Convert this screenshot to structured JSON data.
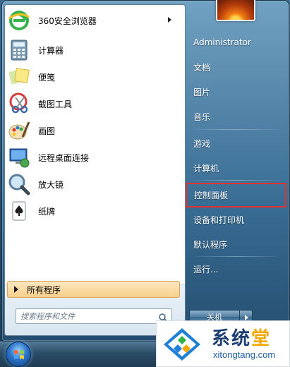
{
  "programs": [
    {
      "label": "360安全浏览器",
      "icon": "browser-360-icon",
      "has_submenu": true
    },
    {
      "label": "计算器",
      "icon": "calculator-icon"
    },
    {
      "label": "便笺",
      "icon": "sticky-notes-icon"
    },
    {
      "label": "截图工具",
      "icon": "snipping-tool-icon"
    },
    {
      "label": "画图",
      "icon": "paint-icon"
    },
    {
      "label": "远程桌面连接",
      "icon": "remote-desktop-icon"
    },
    {
      "label": "放大镜",
      "icon": "magnifier-icon"
    },
    {
      "label": "纸牌",
      "icon": "solitaire-icon"
    }
  ],
  "all_programs_label": "所有程序",
  "search": {
    "placeholder": "搜索程序和文件"
  },
  "right_menu": [
    {
      "label": "Administrator"
    },
    {
      "label": "文档"
    },
    {
      "label": "图片"
    },
    {
      "label": "音乐"
    },
    {
      "label": "游戏"
    },
    {
      "label": "计算机"
    },
    {
      "label": "控制面板",
      "highlighted": true
    },
    {
      "label": "设备和打印机"
    },
    {
      "label": "默认程序"
    },
    {
      "label": "运行..."
    }
  ],
  "shutdown_label": "关机",
  "watermark": {
    "title": "系统",
    "title_accent": "堂",
    "url": "xitongtang.com"
  },
  "colors": {
    "highlight_border": "#e0322f",
    "all_programs_bg": "#f7cf8a",
    "watermark_blue": "#1b3d73"
  }
}
